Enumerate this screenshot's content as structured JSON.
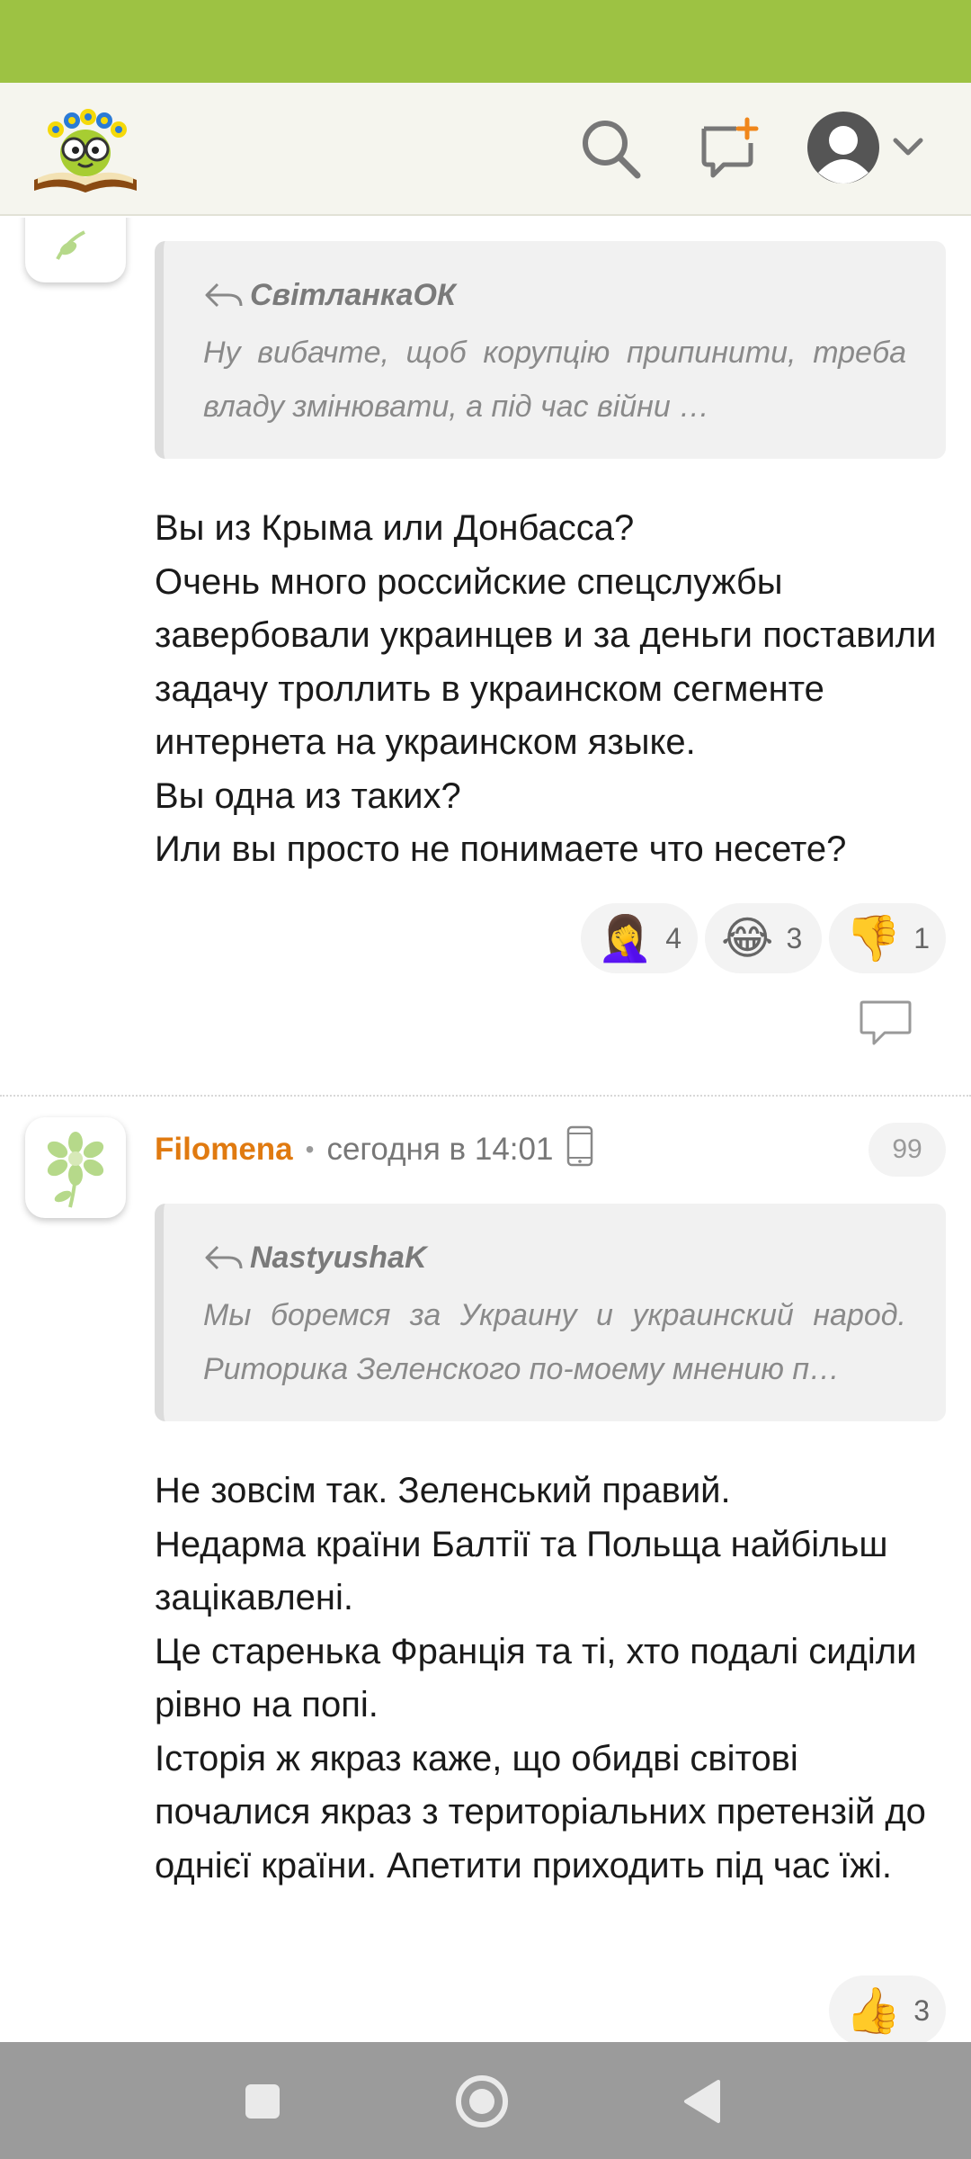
{
  "header": {
    "logo_icon": "bookworm-logo-icon",
    "search_icon": "search-icon",
    "new_post_icon": "new-post-icon",
    "profile_icon": "profile-avatar-icon",
    "chevron_icon": "chevron-down-icon"
  },
  "colors": {
    "status_bar": "#9dc243",
    "header_bg": "#f5f5ee",
    "author_name": "#e07a10",
    "nav_bar": "#9b9b9b"
  },
  "comments": [
    {
      "quote": {
        "author": "СвітланкаОК",
        "text": "Ну вибачте, щоб корупцію припинити, треба владу змінювати, а під час війни …"
      },
      "body": "Вы из Крыма или Донбасса?\nОчень много российские спецслужбы завербовали украинцев и за деньги поставили задачу троллить в украинском сегменте интернета на украинском языке.\nВы одна из таких?\nИли вы просто не понимаете что несете?",
      "reactions": [
        {
          "emoji": "🤦‍♀️",
          "icon": "facepalm-icon",
          "count": "4"
        },
        {
          "emoji": "😂",
          "icon": "laughing-icon",
          "count": "3"
        },
        {
          "emoji": "👎",
          "icon": "thumbs-down-icon",
          "count": "1"
        }
      ]
    },
    {
      "author": "Filomena",
      "separator": "•",
      "time": "сегодня в 14:01",
      "number": "99",
      "quote": {
        "author": "NastyushaK",
        "text": "Мы боремся за Украину и украинский народ. Риторика Зеленского по-моему мнению п…"
      },
      "body": "Не зовсім так. Зеленський правий.\nНедарма країни Балтії та Польща найбільш зацікавлені.\nЦе старенька Франція та ті, хто подалі сиділи рівно на попі.\nІсторія ж якраз каже, що обидві світові почалися якраз з територіальних претензій до однієї країни. Апетити приходить під час їжі.",
      "reactions": [
        {
          "emoji": "👍",
          "icon": "thumbs-up-icon",
          "count": "3"
        }
      ]
    }
  ],
  "nav": {
    "recents_icon": "recents-square-icon",
    "home_icon": "home-circle-icon",
    "back_icon": "back-triangle-icon"
  }
}
